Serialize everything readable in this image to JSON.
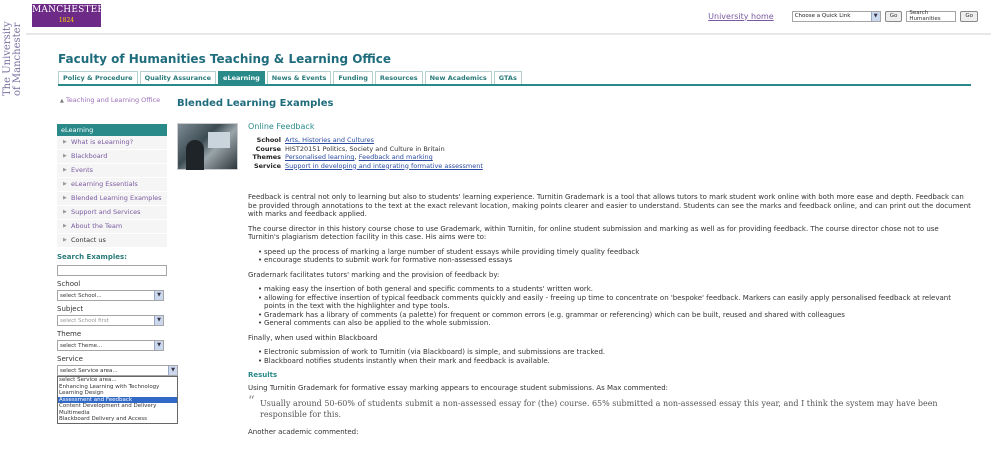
{
  "brand": {
    "side_line1": "The University",
    "side_line2": "of Manchester",
    "logo_line1": "MANCHESTER",
    "logo_line2": "1824",
    "logo_color": "#6d2a87"
  },
  "header": {
    "university_home": "University home",
    "quick_link": "Choose a Quick Link",
    "go1": "Go",
    "search_value": "Search Humanities",
    "go2": "Go"
  },
  "faculty_title": "Faculty of Humanities Teaching & Learning Office",
  "tabs": [
    {
      "label": "Policy & Procedure",
      "active": false
    },
    {
      "label": "Quality Assurance",
      "active": false
    },
    {
      "label": "eLearning",
      "active": true
    },
    {
      "label": "News & Events",
      "active": false
    },
    {
      "label": "Funding",
      "active": false
    },
    {
      "label": "Resources",
      "active": false
    },
    {
      "label": "New Academics",
      "active": false
    },
    {
      "label": "GTAs",
      "active": false
    }
  ],
  "leftnav": {
    "home_link": "Teaching and Learning Office",
    "section": "eLearning",
    "items": [
      {
        "label": "What is eLearning?"
      },
      {
        "label": "Blackboard"
      },
      {
        "label": "Events"
      },
      {
        "label": "eLearning Essentials"
      },
      {
        "label": "Blended Learning Examples"
      },
      {
        "label": "Support and Services"
      },
      {
        "label": "About the Team"
      },
      {
        "label": "Contact us"
      }
    ],
    "search_heading": "Search Examples:",
    "school_label": "School",
    "school_value": "select School...",
    "subject_label": "Subject",
    "subject_value": "select School first",
    "theme_label": "Theme",
    "theme_value": "select Theme...",
    "service_label": "Service",
    "service_value": "select Service area...",
    "service_options": [
      "select Service area...",
      "Enhancing Learning with Technology",
      "Learning Design",
      "Assessment and Feedback",
      "Content Development and Delivery",
      "Multimedia",
      "Blackboard Delivery and Access"
    ],
    "service_selected_index": 3
  },
  "main": {
    "page_title": "Blended Learning Examples",
    "section_title": "Online Feedback",
    "meta": {
      "school_key": "School",
      "school_val": "Arts, Histories and Cultures",
      "course_key": "Course",
      "course_val": "HIST20151 Politics, Society and Culture in Britain",
      "themes_key": "Themes",
      "themes_val1": "Personalised learning",
      "themes_sep": ", ",
      "themes_val2": "Feedback and marking",
      "service_key": "Service",
      "service_val": "Support in developing and integrating formative assessment"
    },
    "p1": "Feedback is central not only to learning but also to students' learning experience. Turnitin Grademark is a tool that allows tutors to mark student work online with both more ease and depth. Feedback can be provided through annotations to the text at the exact relevant location, making points clearer and easier to understand. Students can see the marks and feedback online, and can print out the document with marks and feedback applied.",
    "p2": "The course director in this history course chose to use Grademark, within Turnitin, for online student submission and marking as well as for providing feedback. The course director chose not to use Turnitin's plagiarism detection facility in this case. His aims were to:",
    "list1": [
      "speed up the process of marking a large number of student essays while providing timely quality feedback",
      "encourage students to submit work for formative non-assessed essays"
    ],
    "p3": "Gradernark facilitates tutors' marking and the provision of feedback by:",
    "list2": [
      "making easy the insertion of both general and specific comments to a students' written work.",
      "allowing for effective insertion of typical feedback comments quickly and easily - freeing up time to concentrate on 'bespoke' feedback. Markers can easily apply personalised feedback at relevant points in the text with the highlighter and type tools.",
      "Grademark has a library of comments (a palette) for frequent or common errors (e.g. grammar or referencing) which can be built, reused and shared with colleagues",
      "General comments can also be applied to the whole submission."
    ],
    "p4": "Finally, when used within Blackboard",
    "list3": [
      "Electronic submission of work to Turnitin (via Blackboard) is simple, and submissions are tracked.",
      "Blackboard notifies students instantly when their mark and feedback is available."
    ],
    "results_heading": "Results",
    "p5": "Using Turnitin Grademark for formative essay marking appears to encourage student submissions. As Max commented:",
    "quote_mark": "“",
    "quote": "Usually around 50-60% of students submit a non-assessed essay for (the) course. 65% submitted a non-assessed essay this year, and I think the system may have been responsible for this.",
    "p6": "Another academic commented:"
  }
}
